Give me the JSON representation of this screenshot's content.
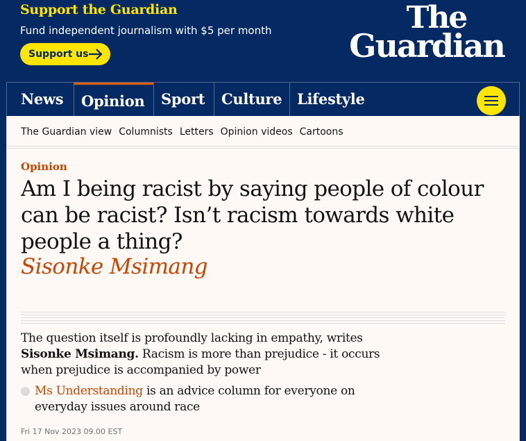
{
  "banner": {
    "title": "Support the Guardian",
    "subtitle": "Fund independent journalism with $5 per month",
    "button_label": "Support us",
    "button_icon": "arrow-right-icon"
  },
  "logo": {
    "line1": "The",
    "line2": "Guardian"
  },
  "nav": {
    "items": [
      {
        "label": "News",
        "active": false
      },
      {
        "label": "Opinion",
        "active": true
      },
      {
        "label": "Sport",
        "active": false
      },
      {
        "label": "Culture",
        "active": false
      },
      {
        "label": "Lifestyle",
        "active": false
      }
    ],
    "menu_icon": "hamburger-menu-icon"
  },
  "subnav": {
    "items": [
      "The Guardian view",
      "Columnists",
      "Letters",
      "Opinion videos",
      "Cartoons"
    ]
  },
  "article": {
    "kicker": "Opinion",
    "headline": "Am I being racist by saying people of colour can be racist? Isn’t racism towards white people a thing?",
    "byline": "Sisonke Msimang",
    "standfirst_lead": "The question itself is profoundly lacking in empathy, writes ",
    "standfirst_author": "Sisonke Msimang.",
    "standfirst_rest": " Racism is more than prejudice - it occurs when prejudice is accompanied by power",
    "bullet_link": "Ms Understanding",
    "bullet_rest": " is an advice column for everyone on everyday issues around race",
    "date": "Fri 17 Nov 2023 09.00 EST"
  },
  "colors": {
    "brand_blue": "#052962",
    "yellow": "#ffe500",
    "opinion_orange": "#c74600",
    "background": "#fef9f5"
  }
}
